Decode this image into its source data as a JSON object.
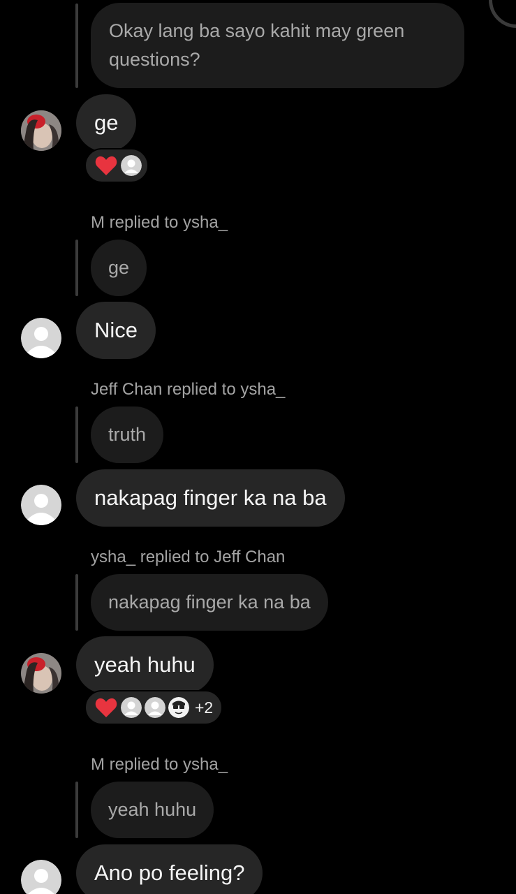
{
  "colors": {
    "background": "#000000",
    "bubble": "#262626",
    "quoted_bubble": "#1c1c1c",
    "heart": "#e8343f"
  },
  "thread": {
    "quoted_top": "Okay lang ba sayo kahit may green questions?",
    "messages": [
      {
        "text": "ge",
        "avatar": "profile-photo-avatar",
        "reactions": {
          "emoji": "heart-icon",
          "count_label": ""
        }
      },
      {
        "reply_header": "M replied to ysha_",
        "quoted": "ge",
        "text": "Nice",
        "avatar": "default-avatar"
      },
      {
        "reply_header": "Jeff Chan replied to ysha_",
        "quoted": "truth",
        "text": "nakapag finger ka na ba",
        "avatar": "default-avatar"
      },
      {
        "reply_header": "ysha_ replied to Jeff Chan",
        "quoted": "nakapag finger ka na ba",
        "text": "yeah huhu",
        "avatar": "profile-photo-avatar",
        "reactions": {
          "emoji": "heart-icon",
          "count_label": "+2"
        }
      },
      {
        "reply_header": "M replied to ysha_",
        "quoted": "yeah huhu",
        "text": "Ano po feeling?",
        "avatar": "default-avatar"
      }
    ]
  }
}
